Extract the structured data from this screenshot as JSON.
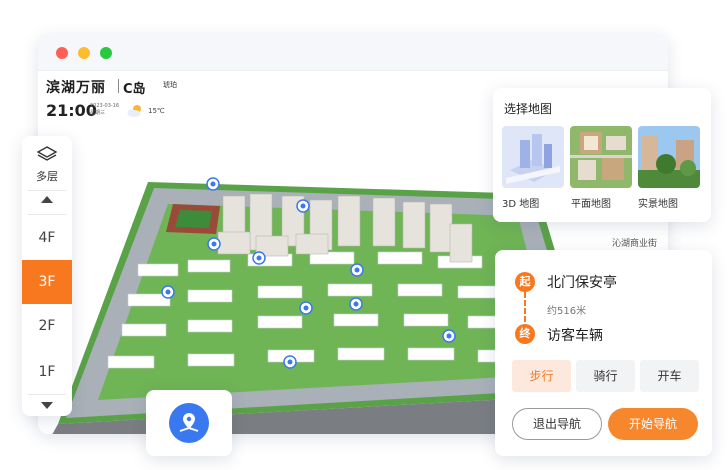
{
  "header": {
    "brand_name": "滨湖万丽",
    "brand_logo": "C岛",
    "brand_logo_sub": "琥珀",
    "time": "21:00",
    "date": "2023-03-16",
    "weekday": "星期三",
    "temperature": "15℃",
    "weather_icon": "partly-cloudy-icon"
  },
  "floors": {
    "layers_label": "多层",
    "items": [
      "4F",
      "3F",
      "2F",
      "1F"
    ],
    "active": "3F"
  },
  "map_picker": {
    "title": "选择地图",
    "options": [
      {
        "label": "3D 地图"
      },
      {
        "label": "平面地图"
      },
      {
        "label": "实景地图"
      }
    ]
  },
  "peek_text": "沁湖商业街",
  "navigation": {
    "start_badge": "起",
    "end_badge": "终",
    "start": "北门保安亭",
    "distance": "约516米",
    "destination": "访客车辆",
    "modes": [
      "步行",
      "骑行",
      "开车"
    ],
    "active_mode": "步行",
    "exit_label": "退出导航",
    "start_label": "开始导航"
  },
  "colors": {
    "accent": "#f7781e",
    "marker": "#3a78f0",
    "dot_red": "#ff5f57",
    "dot_yellow": "#febc2e",
    "dot_green": "#28c840"
  }
}
